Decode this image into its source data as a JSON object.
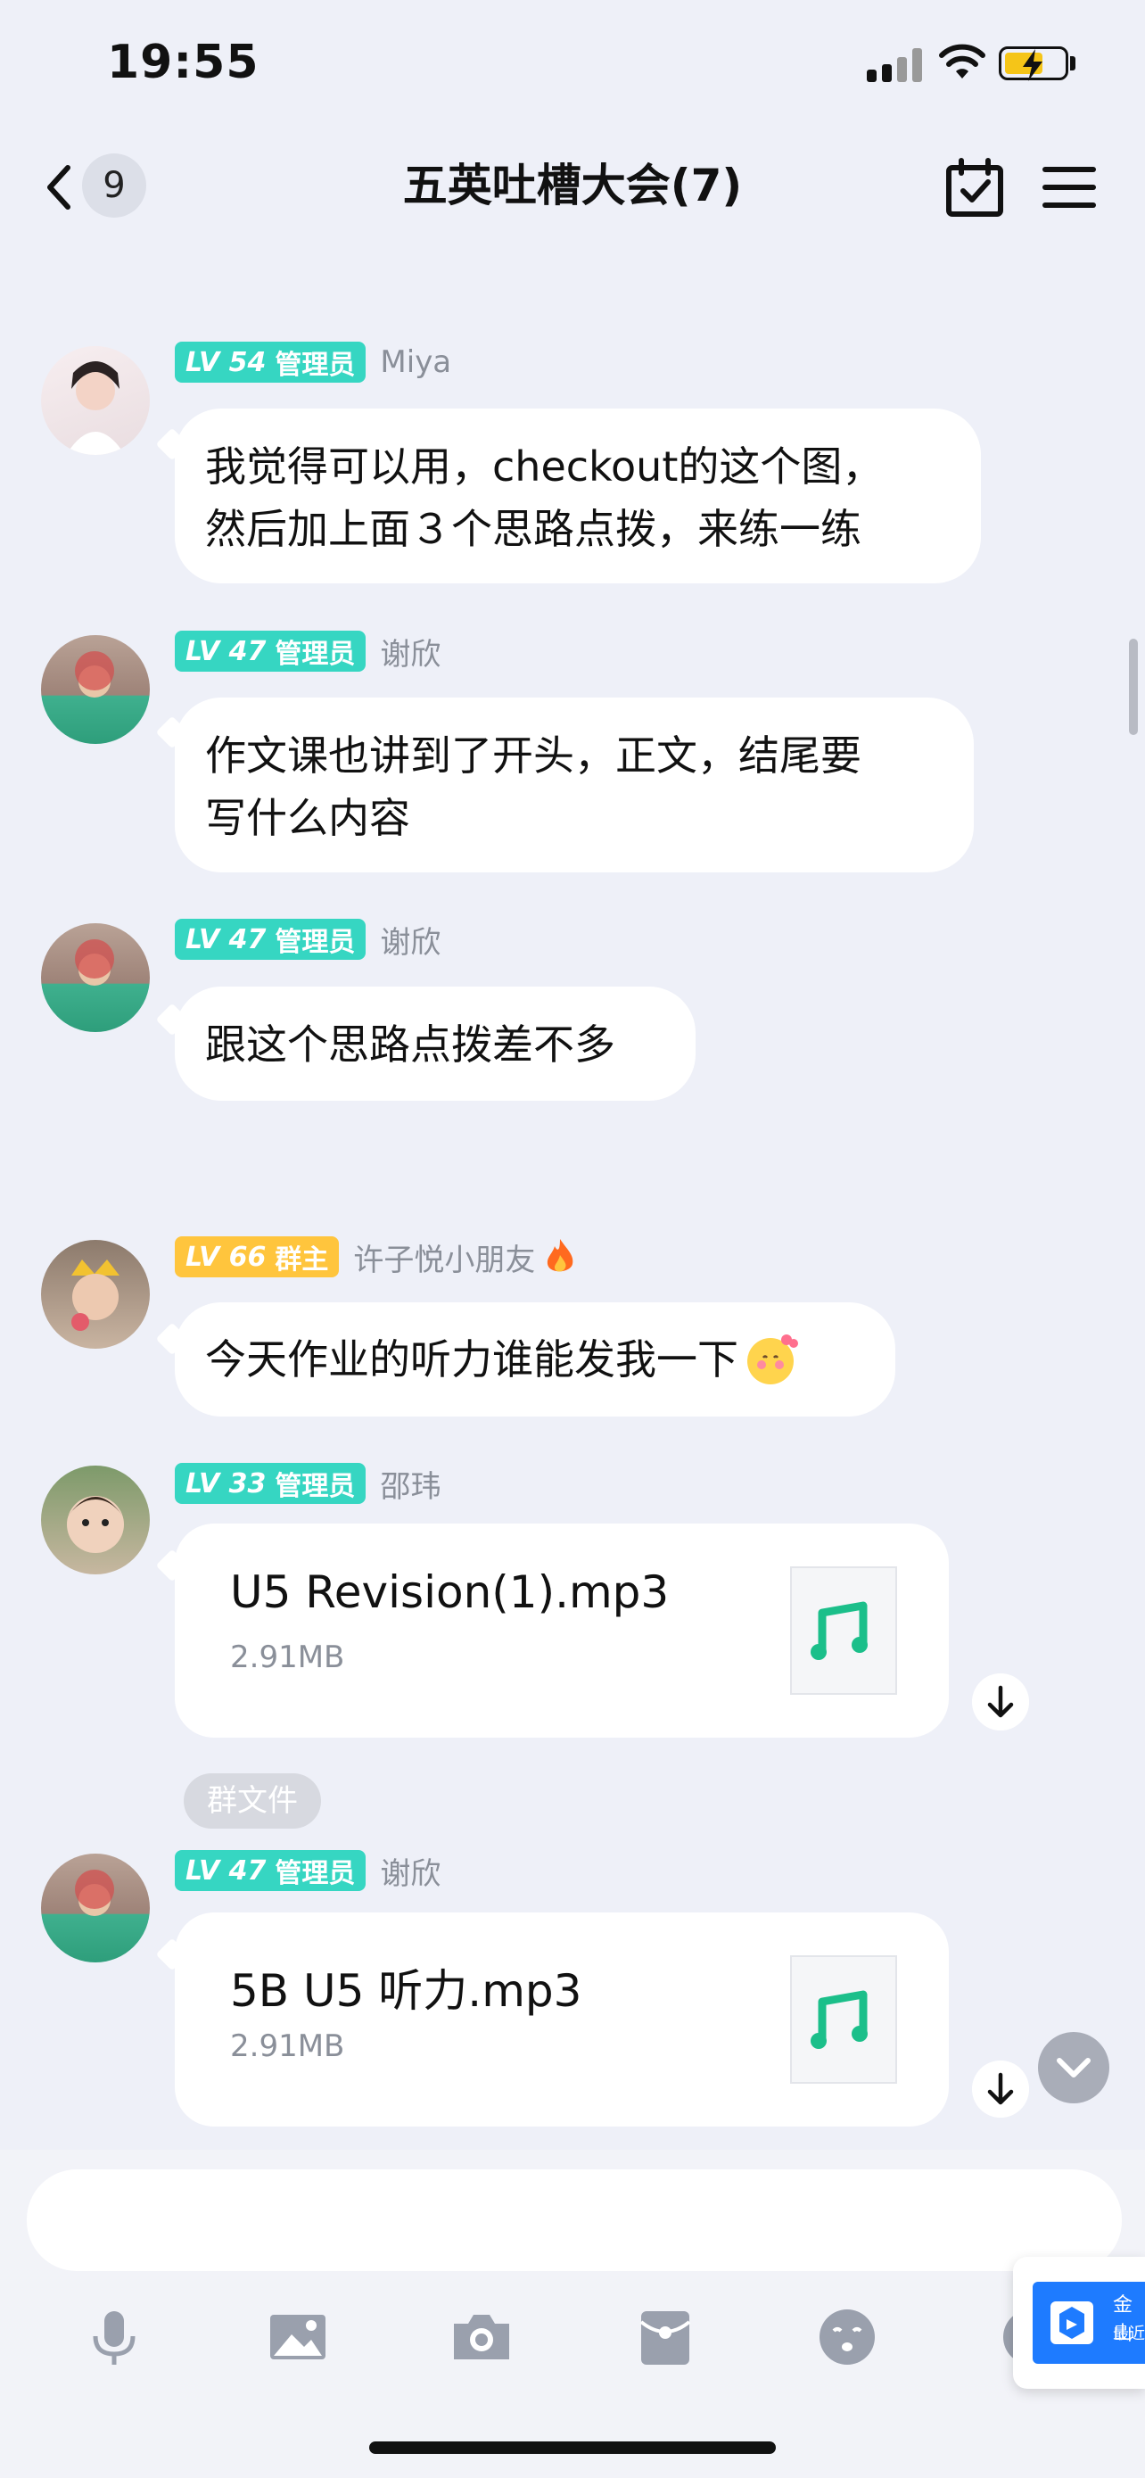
{
  "status_bar": {
    "time": "19:55"
  },
  "nav": {
    "back_count": "9",
    "title": "五英吐槽大会(7)"
  },
  "messages": [
    {
      "level": "LV 54",
      "role": "管理员",
      "sender": "Miya",
      "text_lines": [
        "我觉得可以用，checkout的这个图，",
        "然后加上面３个思路点拨，来练一练"
      ]
    },
    {
      "level": "LV 47",
      "role": "管理员",
      "sender": "谢欣",
      "text_lines": [
        "作文课也讲到了开头，正文，结尾要",
        "写什么内容"
      ]
    },
    {
      "level": "LV 47",
      "role": "管理员",
      "sender": "谢欣",
      "text_lines": [
        "跟这个思路点拨差不多"
      ]
    },
    {
      "level": "LV 66",
      "role": "群主",
      "sender": "许子悦小朋友",
      "text_lines": [
        "今天作业的听力谁能发我一下"
      ]
    },
    {
      "level": "LV 33",
      "role": "管理员",
      "sender": "邵玮",
      "file": {
        "name": "U5 Revision(1).mp3",
        "size": "2.91MB"
      }
    },
    {
      "level": "LV 47",
      "role": "管理员",
      "sender": "谢欣",
      "tag": "群文件",
      "file": {
        "name": "5B U5 听力.mp3",
        "size": "2.91MB"
      }
    }
  ],
  "input": {
    "placeholder": ""
  },
  "toolbar": [
    "microphone-icon",
    "image-icon",
    "camera-icon",
    "red-packet-icon",
    "emoji-icon"
  ],
  "popup": {
    "line1": "金山",
    "line2": "最近"
  },
  "colors": {
    "admin_badge": "#36d6c2",
    "owner_badge": "#ffc53d",
    "file_icon": "#1bbf8a",
    "background": "#eef0f8"
  }
}
